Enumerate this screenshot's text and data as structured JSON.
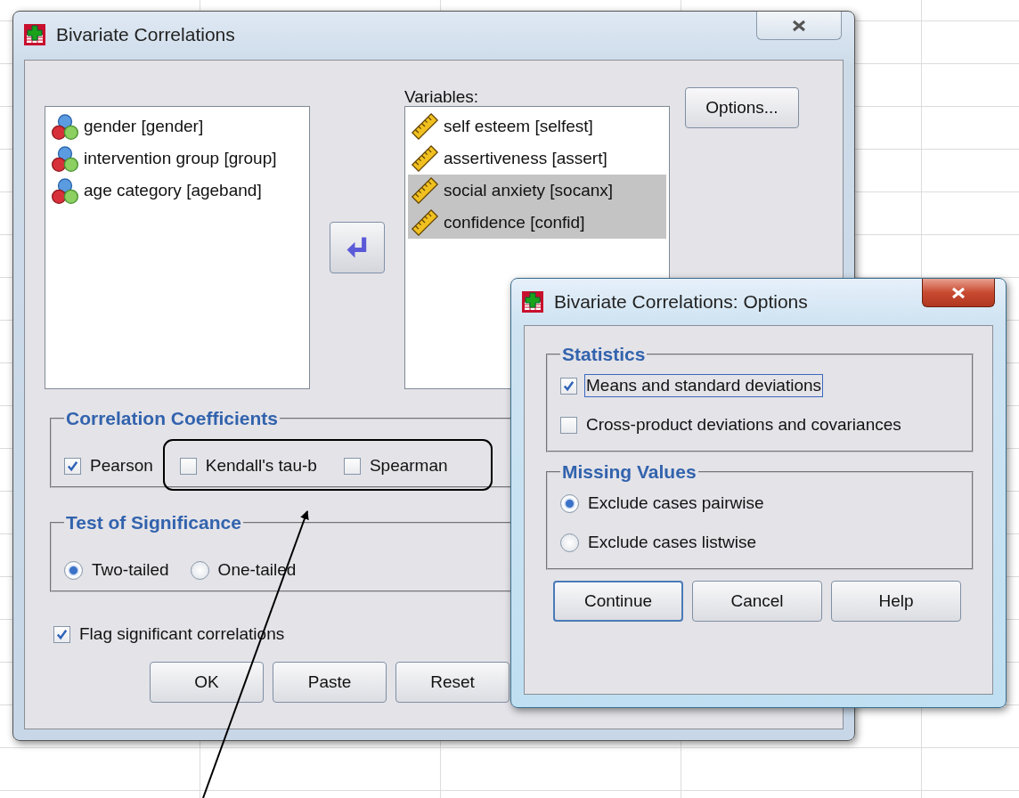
{
  "main_dialog": {
    "title": "Bivariate Correlations",
    "source_variables": [
      {
        "label": "gender [gender]",
        "selected": false
      },
      {
        "label": "intervention group [group]",
        "selected": false
      },
      {
        "label": "age category [ageband]",
        "selected": false
      }
    ],
    "variables_label": "Variables:",
    "variables": [
      {
        "label": "self esteem [selfest]",
        "selected": false
      },
      {
        "label": "assertiveness [assert]",
        "selected": false
      },
      {
        "label": "social anxiety [socanx]",
        "selected": true
      },
      {
        "label": "confidence [confid]",
        "selected": true
      }
    ],
    "options_button": "Options...",
    "correlation_coefficients": {
      "title": "Correlation Coefficients",
      "options": [
        {
          "label": "Pearson",
          "checked": true
        },
        {
          "label": "Kendall's tau-b",
          "checked": false
        },
        {
          "label": "Spearman",
          "checked": false
        }
      ]
    },
    "test_of_significance": {
      "title": "Test of Significance",
      "options": [
        {
          "label": "Two-tailed",
          "selected": true
        },
        {
          "label": "One-tailed",
          "selected": false
        }
      ]
    },
    "flag_significant": {
      "label": "Flag significant correlations",
      "checked": true
    },
    "buttons": [
      "OK",
      "Paste",
      "Reset"
    ]
  },
  "options_dialog": {
    "title": "Bivariate Correlations: Options",
    "statistics": {
      "title": "Statistics",
      "options": [
        {
          "label": "Means and standard deviations",
          "checked": true,
          "focused": true
        },
        {
          "label": "Cross-product deviations and covariances",
          "checked": false,
          "focused": false
        }
      ]
    },
    "missing_values": {
      "title": "Missing Values",
      "options": [
        {
          "label": "Exclude cases pairwise",
          "selected": true
        },
        {
          "label": "Exclude cases listwise",
          "selected": false
        }
      ]
    },
    "buttons": [
      {
        "label": "Continue",
        "default": true
      },
      {
        "label": "Cancel",
        "default": false
      },
      {
        "label": "Help",
        "default": false
      }
    ]
  }
}
